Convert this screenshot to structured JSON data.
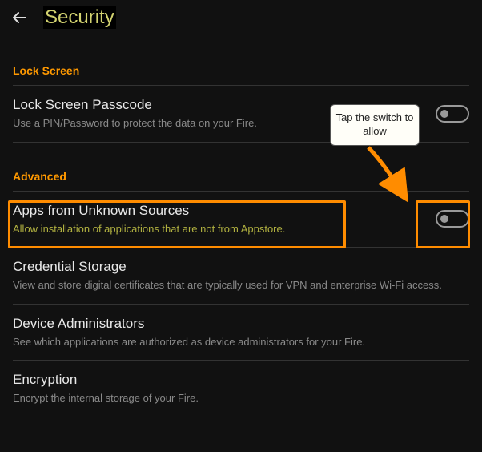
{
  "header": {
    "title": "Security"
  },
  "sections": {
    "lockscreen": {
      "label": "Lock Screen"
    },
    "advanced": {
      "label": "Advanced"
    }
  },
  "rows": {
    "passcode": {
      "title": "Lock Screen Passcode",
      "desc": "Use a PIN/Password to protect the data on your Fire."
    },
    "unknown": {
      "title": "Apps from Unknown Sources",
      "desc": "Allow installation of applications that are not from Appstore."
    },
    "credential": {
      "title": "Credential Storage",
      "desc": "View and store digital certificates that are typically used for VPN and enterprise Wi-Fi access."
    },
    "deviceadmin": {
      "title": "Device Administrators",
      "desc": "See which applications are authorized as device administrators for your Fire."
    },
    "encryption": {
      "title": "Encryption",
      "desc": "Encrypt the internal storage of your Fire."
    }
  },
  "callout": {
    "text": "Tap the switch to allow"
  },
  "colors": {
    "accent": "#ff9900",
    "highlight": "#ff8c00"
  }
}
